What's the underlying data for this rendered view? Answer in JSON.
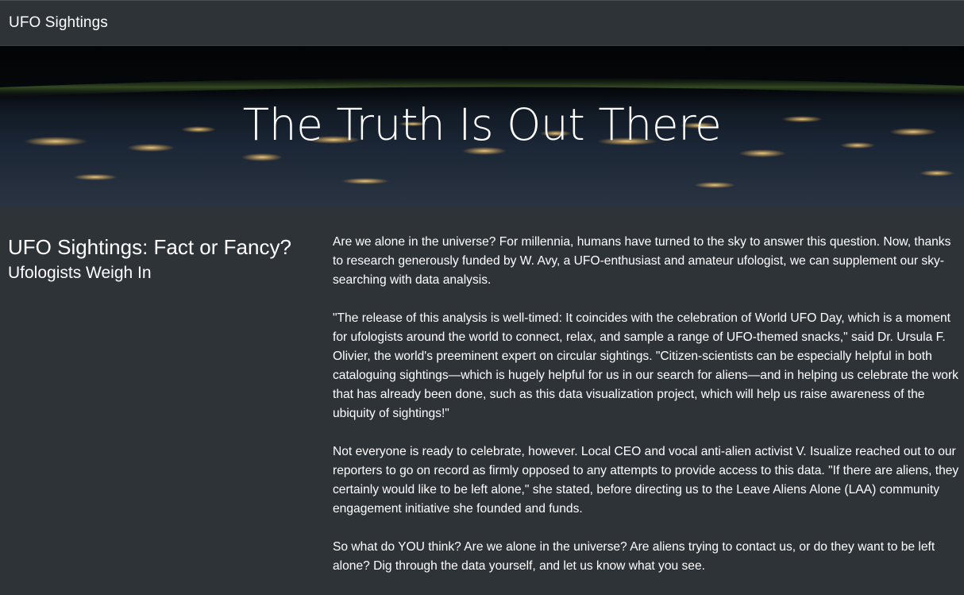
{
  "navbar": {
    "brand": "UFO Sightings"
  },
  "hero": {
    "title": "The Truth Is Out There"
  },
  "sidebar": {
    "heading": "UFO Sightings: Fact or Fancy?",
    "subheading": "Ufologists Weigh In"
  },
  "article": {
    "paragraphs": [
      "Are we alone in the universe? For millennia, humans have turned to the sky to answer this question. Now, thanks to research generously funded by W. Avy, a UFO-enthusiast and amateur ufologist, we can supplement our sky-searching with data analysis.",
      "\"The release of this analysis is well-timed: It coincides with the celebration of World UFO Day, which is a moment for ufologists around the world to connect, relax, and sample a range of UFO-themed snacks,\" said Dr. Ursula F. Olivier, the world's preeminent expert on circular sightings. \"Citizen-scientists can be especially helpful in both cataloguing sightings—which is hugely helpful for us in our search for aliens—and in helping us celebrate the work that has already been done, such as this data visualization project, which will help us raise awareness of the ubiquity of sightings!\"",
      "Not everyone is ready to celebrate, however. Local CEO and vocal anti-alien activist V. Isualize reached out to our reporters to go on record as firmly opposed to any attempts to provide access to this data. \"If there are aliens, they certainly would like to be left alone,\" she stated, before directing us to the Leave Aliens Alone (LAA) community engagement initiative she founded and funds.",
      "So what do YOU think? Are we alone in the universe? Are aliens trying to contact us, or do they want to be left alone? Dig through the data yourself, and let us know what you see."
    ]
  },
  "colors": {
    "background": "#2e3338",
    "text": "#ffffff",
    "city_lights": "#f3c77a"
  }
}
